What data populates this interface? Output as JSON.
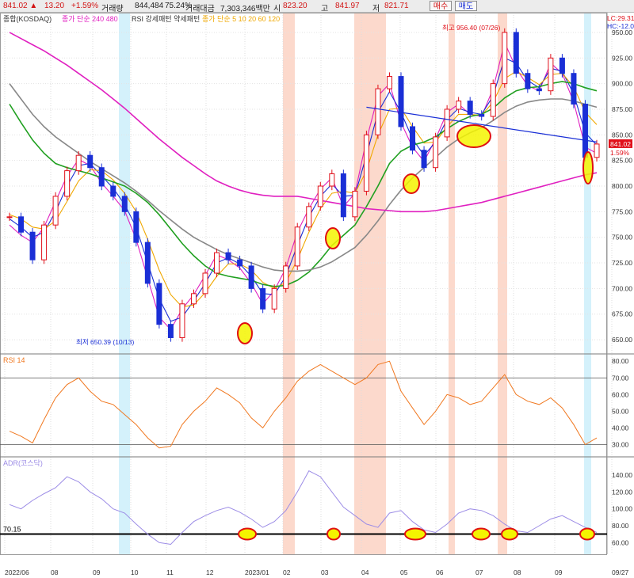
{
  "toolbar": {
    "price": "841.02 ▲",
    "change": "13.20",
    "change_pct": "+1.59%",
    "volume_label": "거래량",
    "volume": "844,484",
    "volume_ratio": "75.24%",
    "amount_label": "거래대금",
    "amount": "7,303,346백만",
    "open_label": "시",
    "open": "823.20",
    "high_label": "고",
    "high": "841.97",
    "low_label": "저",
    "low": "821.71",
    "buy_label": "매수",
    "sell_label": "매도"
  },
  "price_panel": {
    "legend_title": "종합(KOSDAQ)",
    "legend_ma_long": "종가 단순 240  480",
    "legend_rsi_pattern": "RSI 강세패턴  약세패턴",
    "legend_ma_short": "종가 단순 5  10  20  60  120",
    "lc_label": "LC:29.31",
    "hc_label": "HC:-12.08",
    "current_price_label": "841.02",
    "current_pct_label": "1.59%",
    "high_annotation": "최고 956.40 (07/26)",
    "low_annotation": "최저 650.39 (10/13)"
  },
  "rsi_panel": {
    "title": "RSI 14"
  },
  "adr_panel": {
    "title": "ADR(코스닥)",
    "level_label": "70.15"
  },
  "colors": {
    "candle_up": "#e0101a",
    "candle_down": "#1a2fd6",
    "ma5": "#e020c0",
    "ma10": "#1a2fd6",
    "ma20": "#f0a800",
    "ma60": "#20a020",
    "ma120": "#888888",
    "ma240": "#e020c0",
    "rsi": "#f07820",
    "adr": "#9c8ce6",
    "pink_band": "#fcd9cc",
    "cyan_band": "#d4f1fb",
    "highlight": "#f4f400"
  },
  "chart_data": [
    {
      "type": "candlestick",
      "title": "종합(KOSDAQ)",
      "x_tick_labels": [
        "2022/06",
        "08",
        "09",
        "10",
        "11",
        "12",
        "2023/01",
        "02",
        "03",
        "04",
        "05",
        "06",
        "07",
        "08",
        "09",
        "09/27"
      ],
      "y_ticks": [
        650,
        675,
        700,
        725,
        750,
        775,
        800,
        825,
        850,
        875,
        900,
        925,
        950
      ],
      "ylim": [
        640,
        960
      ],
      "last_close": 841.02,
      "period_high": {
        "date": "07/26",
        "value": 956.4
      },
      "period_low": {
        "date": "10/13",
        "value": 650.39
      },
      "close_path": [
        {
          "m": "2022/06",
          "v": 770
        },
        {
          "m": "06",
          "v": 755
        },
        {
          "m": "06",
          "v": 728
        },
        {
          "m": "07",
          "v": 762
        },
        {
          "m": "07",
          "v": 790
        },
        {
          "m": "07",
          "v": 815
        },
        {
          "m": "08",
          "v": 830
        },
        {
          "m": "08",
          "v": 818
        },
        {
          "m": "08",
          "v": 800
        },
        {
          "m": "08",
          "v": 790
        },
        {
          "m": "09",
          "v": 775
        },
        {
          "m": "09",
          "v": 745
        },
        {
          "m": "09",
          "v": 705
        },
        {
          "m": "10",
          "v": 665
        },
        {
          "m": "10",
          "v": 652
        },
        {
          "m": "10",
          "v": 685
        },
        {
          "m": "11",
          "v": 695
        },
        {
          "m": "11",
          "v": 715
        },
        {
          "m": "11",
          "v": 735
        },
        {
          "m": "12",
          "v": 728
        },
        {
          "m": "12",
          "v": 722
        },
        {
          "m": "12",
          "v": 700
        },
        {
          "m": "2023/01",
          "v": 680
        },
        {
          "m": "01",
          "v": 700
        },
        {
          "m": "01",
          "v": 722
        },
        {
          "m": "02",
          "v": 760
        },
        {
          "m": "02",
          "v": 780
        },
        {
          "m": "03",
          "v": 800
        },
        {
          "m": "03",
          "v": 812
        },
        {
          "m": "03",
          "v": 770
        },
        {
          "m": "03",
          "v": 795
        },
        {
          "m": "04",
          "v": 850
        },
        {
          "m": "04",
          "v": 895
        },
        {
          "m": "04",
          "v": 907
        },
        {
          "m": "05",
          "v": 858
        },
        {
          "m": "05",
          "v": 835
        },
        {
          "m": "05",
          "v": 818
        },
        {
          "m": "05",
          "v": 848
        },
        {
          "m": "06",
          "v": 875
        },
        {
          "m": "06",
          "v": 883
        },
        {
          "m": "06",
          "v": 870
        },
        {
          "m": "07",
          "v": 868
        },
        {
          "m": "07",
          "v": 900
        },
        {
          "m": "07",
          "v": 950
        },
        {
          "m": "08",
          "v": 910
        },
        {
          "m": "08",
          "v": 895
        },
        {
          "m": "08",
          "v": 893
        },
        {
          "m": "09",
          "v": 925
        },
        {
          "m": "09",
          "v": 910
        },
        {
          "m": "09",
          "v": 880
        },
        {
          "m": "09",
          "v": 828
        },
        {
          "m": "09/27",
          "v": 841.02
        }
      ],
      "moving_averages": [
        {
          "name": "5",
          "values": [
            762,
            752,
            745,
            760,
            785,
            810,
            826,
            820,
            803,
            790,
            776,
            748,
            710,
            672,
            660,
            680,
            694,
            713,
            733,
            728,
            720,
            705,
            685,
            698,
            720,
            755,
            778,
            797,
            808,
            780,
            793,
            845,
            888,
            900,
            862,
            838,
            824,
            846,
            872,
            880,
            870,
            868,
            895,
            940,
            915,
            898,
            893,
            920,
            910,
            882,
            838,
            832
          ]
        },
        {
          "name": "10",
          "values": [
            768,
            760,
            750,
            755,
            775,
            800,
            820,
            822,
            810,
            798,
            782,
            760,
            725,
            690,
            668,
            672,
            688,
            705,
            725,
            730,
            724,
            712,
            695,
            694,
            712,
            742,
            770,
            790,
            802,
            790,
            791,
            830,
            872,
            892,
            872,
            846,
            830,
            843,
            865,
            876,
            872,
            870,
            888,
            925,
            920,
            903,
            896,
            915,
            912,
            890,
            852,
            840
          ]
        },
        {
          "name": "20",
          "values": [
            772,
            768,
            760,
            758,
            766,
            785,
            805,
            816,
            815,
            806,
            793,
            775,
            748,
            718,
            694,
            682,
            684,
            696,
            712,
            724,
            724,
            718,
            706,
            700,
            706,
            728,
            755,
            778,
            793,
            795,
            793,
            815,
            850,
            875,
            876,
            858,
            842,
            843,
            858,
            870,
            870,
            869,
            882,
            905,
            912,
            906,
            899,
            909,
            910,
            897,
            872,
            860
          ]
        },
        {
          "name": "60",
          "values": [
            880,
            862,
            845,
            832,
            822,
            818,
            815,
            812,
            808,
            804,
            800,
            793,
            784,
            772,
            758,
            744,
            732,
            722,
            715,
            712,
            710,
            708,
            704,
            702,
            703,
            708,
            716,
            728,
            742,
            752,
            762,
            780,
            800,
            822,
            834,
            840,
            843,
            848,
            856,
            863,
            868,
            870,
            876,
            886,
            893,
            896,
            897,
            900,
            902,
            900,
            896,
            893
          ]
        },
        {
          "name": "120",
          "values": [
            900,
            885,
            870,
            858,
            848,
            840,
            832,
            824,
            817,
            810,
            803,
            795,
            786,
            776,
            767,
            758,
            750,
            744,
            738,
            733,
            729,
            725,
            721,
            718,
            717,
            717,
            718,
            721,
            726,
            733,
            740,
            752,
            766,
            782,
            796,
            808,
            818,
            828,
            838,
            846,
            852,
            857,
            864,
            872,
            878,
            882,
            884,
            885,
            885,
            883,
            880,
            877
          ]
        },
        {
          "name": "240",
          "values": [
            950,
            944,
            938,
            932,
            925,
            918,
            910,
            902,
            894,
            885,
            876,
            866,
            856,
            846,
            837,
            828,
            820,
            812,
            805,
            800,
            796,
            793,
            791,
            790,
            790,
            790,
            788,
            786,
            784,
            782,
            780,
            778,
            777,
            776,
            775,
            775,
            775,
            776,
            778,
            780,
            782,
            784,
            787,
            790,
            793,
            796,
            799,
            802,
            805,
            808,
            811,
            813
          ]
        }
      ],
      "support_resistance": [
        {
          "label": "from 04 to 09",
          "start": 877,
          "end": 843
        }
      ]
    },
    {
      "type": "line",
      "title": "RSI 14",
      "y_ticks": [
        30,
        40,
        50,
        60,
        70,
        80
      ],
      "ylim": [
        25,
        82
      ],
      "reference_lines": [
        70,
        30
      ],
      "values": [
        38,
        35,
        31,
        45,
        58,
        66,
        70,
        62,
        56,
        54,
        48,
        42,
        34,
        28,
        29,
        42,
        50,
        56,
        64,
        60,
        55,
        46,
        40,
        50,
        58,
        68,
        74,
        78,
        74,
        70,
        66,
        70,
        78,
        80,
        62,
        52,
        42,
        50,
        60,
        58,
        54,
        56,
        64,
        72,
        60,
        56,
        54,
        58,
        52,
        42,
        30,
        34
      ]
    },
    {
      "type": "line",
      "title": "ADR(코스닥)",
      "y_ticks": [
        60,
        80,
        100,
        120,
        140
      ],
      "ylim": [
        50,
        155
      ],
      "reference_line": 70.15,
      "values": [
        105,
        100,
        110,
        118,
        125,
        138,
        132,
        120,
        112,
        100,
        95,
        82,
        70,
        60,
        58,
        72,
        85,
        92,
        98,
        102,
        96,
        88,
        78,
        85,
        98,
        120,
        145,
        138,
        120,
        102,
        92,
        82,
        78,
        95,
        98,
        85,
        75,
        72,
        82,
        95,
        100,
        98,
        92,
        82,
        74,
        72,
        80,
        88,
        92,
        85,
        78,
        72
      ]
    }
  ],
  "highlight_bands": [
    {
      "kind": "cyan",
      "from": "09",
      "to": "10"
    },
    {
      "kind": "pink",
      "from": "02",
      "to": "02"
    },
    {
      "kind": "pink",
      "from": "04",
      "to": "04"
    },
    {
      "kind": "pink",
      "from": "06",
      "to": "06"
    },
    {
      "kind": "pink",
      "from": "07",
      "to": "08"
    },
    {
      "kind": "cyan",
      "from": "09",
      "to": "09/27"
    }
  ]
}
